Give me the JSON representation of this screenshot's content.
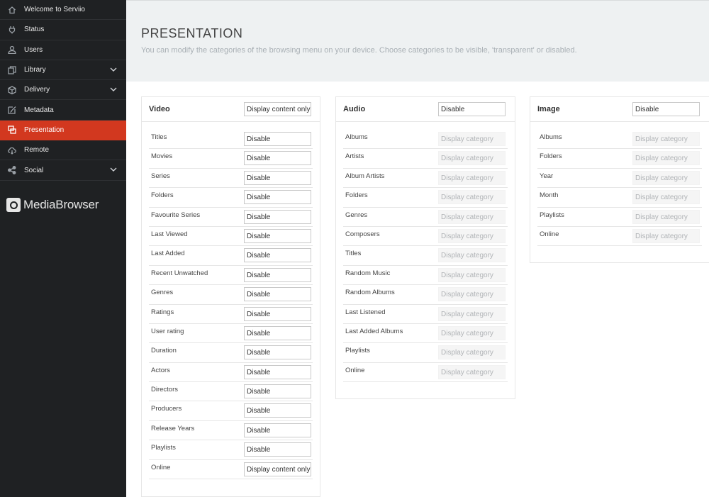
{
  "sidebar": {
    "items": [
      {
        "label": "Welcome to Serviio"
      },
      {
        "label": "Status"
      },
      {
        "label": "Users"
      },
      {
        "label": "Library"
      },
      {
        "label": "Delivery"
      },
      {
        "label": "Metadata"
      },
      {
        "label": "Presentation"
      },
      {
        "label": "Remote"
      },
      {
        "label": "Social"
      }
    ],
    "brand": "MediaBrowser"
  },
  "header": {
    "title": "PRESENTATION",
    "subtitle": "You can modify the categories of the browsing menu on your device. Choose categories to be visible, 'transparent' or disabled."
  },
  "video": {
    "title": "Video",
    "mode": "Display content only",
    "rows": [
      {
        "label": "Titles",
        "value": "Disable"
      },
      {
        "label": "Movies",
        "value": "Disable"
      },
      {
        "label": "Series",
        "value": "Disable"
      },
      {
        "label": "Folders",
        "value": "Disable"
      },
      {
        "label": "Favourite Series",
        "value": "Disable"
      },
      {
        "label": "Last Viewed",
        "value": "Disable"
      },
      {
        "label": "Last Added",
        "value": "Disable"
      },
      {
        "label": "Recent Unwatched",
        "value": "Disable"
      },
      {
        "label": "Genres",
        "value": "Disable"
      },
      {
        "label": "Ratings",
        "value": "Disable"
      },
      {
        "label": "User rating",
        "value": "Disable"
      },
      {
        "label": "Duration",
        "value": "Disable"
      },
      {
        "label": "Actors",
        "value": "Disable"
      },
      {
        "label": "Directors",
        "value": "Disable"
      },
      {
        "label": "Producers",
        "value": "Disable"
      },
      {
        "label": "Release Years",
        "value": "Disable"
      },
      {
        "label": "Playlists",
        "value": "Disable"
      },
      {
        "label": "Online",
        "value": "Display content only"
      }
    ]
  },
  "audio": {
    "title": "Audio",
    "mode": "Disable",
    "rows": [
      {
        "label": "Albums",
        "value": "Display category"
      },
      {
        "label": "Artists",
        "value": "Display category"
      },
      {
        "label": "Album Artists",
        "value": "Display category"
      },
      {
        "label": "Folders",
        "value": "Display category"
      },
      {
        "label": "Genres",
        "value": "Display category"
      },
      {
        "label": "Composers",
        "value": "Display category"
      },
      {
        "label": "Titles",
        "value": "Display category"
      },
      {
        "label": "Random Music",
        "value": "Display category"
      },
      {
        "label": "Random Albums",
        "value": "Display category"
      },
      {
        "label": "Last Listened",
        "value": "Display category"
      },
      {
        "label": "Last Added Albums",
        "value": "Display category"
      },
      {
        "label": "Playlists",
        "value": "Display category"
      },
      {
        "label": "Online",
        "value": "Display category"
      }
    ]
  },
  "image": {
    "title": "Image",
    "mode": "Disable",
    "rows": [
      {
        "label": "Albums",
        "value": "Display category"
      },
      {
        "label": "Folders",
        "value": "Display category"
      },
      {
        "label": "Year",
        "value": "Display category"
      },
      {
        "label": "Month",
        "value": "Display category"
      },
      {
        "label": "Playlists",
        "value": "Display category"
      },
      {
        "label": "Online",
        "value": "Display category"
      }
    ]
  },
  "colors": {
    "sidebar_bg": "#1f2123",
    "accent": "#d2381f",
    "header_bg": "#eef1f2"
  }
}
